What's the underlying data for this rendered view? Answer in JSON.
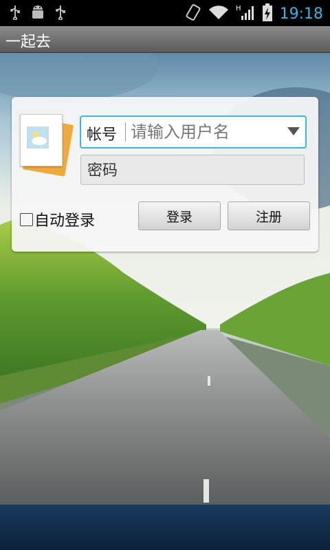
{
  "status_bar": {
    "time": "19:18",
    "left_icons": [
      "usb-icon",
      "android-debug-icon",
      "usb-icon"
    ],
    "right_icons": [
      "rotate-icon",
      "wifi-icon",
      "signal-h-icon",
      "battery-charging-icon"
    ],
    "network_type": "H",
    "time_color": "#33b5e5"
  },
  "app": {
    "title": "一起去"
  },
  "login": {
    "account_label": "帐号",
    "account_placeholder": "请输入用户名",
    "password_placeholder": "密码",
    "auto_login_label": "自动登录",
    "auto_login_checked": false,
    "login_button": "登录",
    "register_button": "注册"
  },
  "colors": {
    "accent": "#33b5e5",
    "titlebar": "#6e6e6e",
    "bottom_band": "#12304f"
  }
}
